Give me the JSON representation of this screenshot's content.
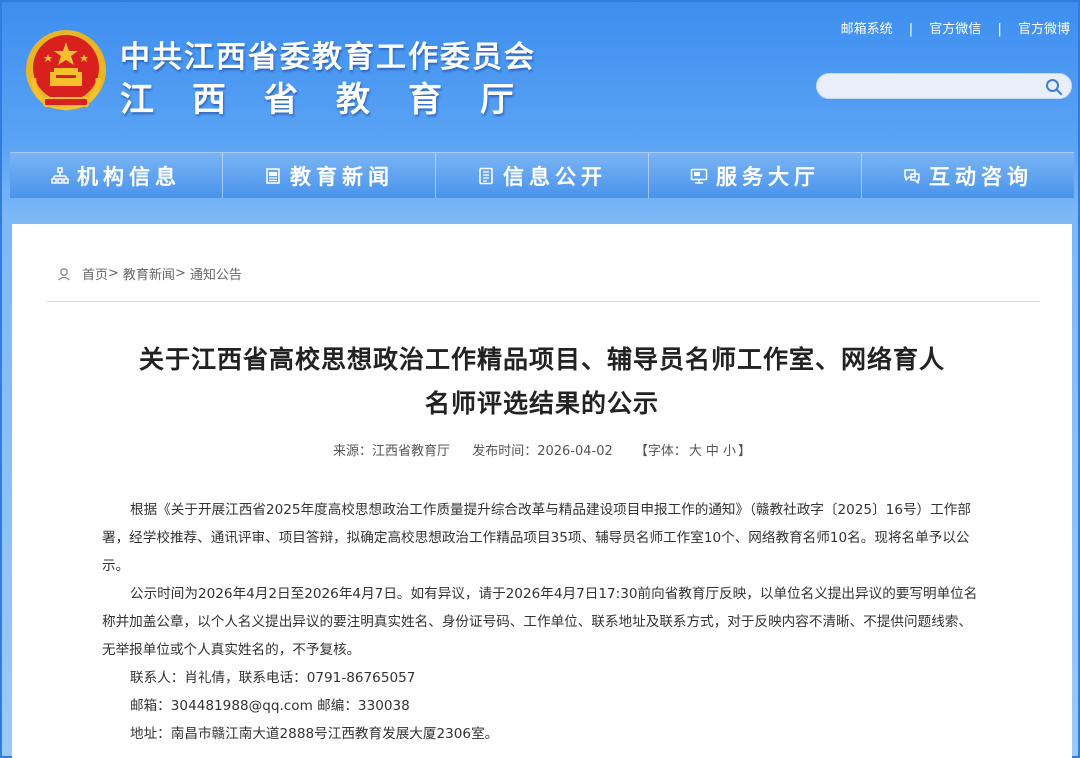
{
  "header": {
    "org_line1": "中共江西省委教育工作委员会",
    "org_line2": "江西省教育厅",
    "toplinks": [
      "邮箱系统",
      "官方微信",
      "官方微博"
    ],
    "separator": "|",
    "search_placeholder": ""
  },
  "nav": [
    {
      "label": "机构信息",
      "icon": "org-tree-icon"
    },
    {
      "label": "教育新闻",
      "icon": "news-doc-icon"
    },
    {
      "label": "信息公开",
      "icon": "list-doc-icon"
    },
    {
      "label": "服务大厅",
      "icon": "monitor-icon"
    },
    {
      "label": "互动咨询",
      "icon": "chat-bubble-icon"
    }
  ],
  "breadcrumb": {
    "icon": "location-pin-icon",
    "items": [
      "首页",
      "教育新闻",
      "通知公告"
    ],
    "separator": ">"
  },
  "article": {
    "title_line1": "关于江西省高校思想政治工作精品项目、辅导员名师工作室、网络育人",
    "title_line2": "名师评选结果的公示",
    "source": "来源：江西省教育厅",
    "publish_time": "发布时间：2026-04-02",
    "font_size_label": "【字体：",
    "font_sizes": [
      "大",
      "中",
      "小"
    ],
    "font_size_close": "】",
    "paragraphs": [
      "根据《关于开展江西省2025年度高校思想政治工作质量提升综合改革与精品建设项目申报工作的通知》（赣教社政字〔2025〕16号）工作部署，经学校推荐、通讯评审、项目答辩，拟确定高校思想政治工作精品项目35项、辅导员名师工作室10个、网络教育名师10名。现将名单予以公示。",
      "公示时间为2026年4月2日至2026年4月7日。如有异议，请于2026年4月7日17:30前向省教育厅反映，以单位名义提出异议的要写明单位名称并加盖公章，以个人名义提出异议的要注明真实姓名、身份证号码、工作单位、联系地址及联系方式，对于反映内容不清晰、不提供问题线索、无举报单位或个人真实姓名的，不予复核。"
    ],
    "contacts": [
      "联系人：肖礼倩，联系电话：0791-86765057",
      "邮箱：304481988@qq.com  邮编：330038",
      "地址：南昌市赣江南大道2888号江西教育发展大厦2306室。"
    ]
  },
  "colors": {
    "header_blue": "#3d8ef0",
    "emblem_red": "#d8201e",
    "emblem_gold": "#f5c02c",
    "title_text": "#222222"
  }
}
